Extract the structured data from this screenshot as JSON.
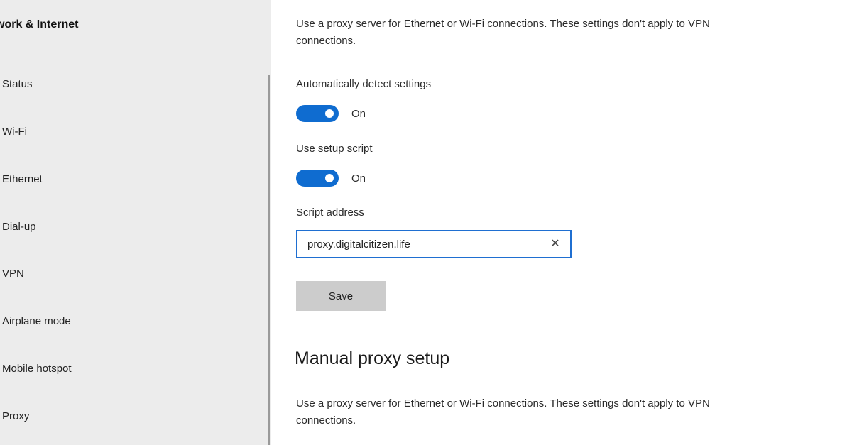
{
  "sidebar": {
    "title": "work & Internet",
    "items": [
      {
        "label": "Status"
      },
      {
        "label": "Wi-Fi"
      },
      {
        "label": "Ethernet"
      },
      {
        "label": "Dial-up"
      },
      {
        "label": "VPN"
      },
      {
        "label": "Airplane mode"
      },
      {
        "label": "Mobile hotspot"
      },
      {
        "label": "Proxy"
      }
    ]
  },
  "automatic": {
    "description": "Use a proxy server for Ethernet or Wi-Fi connections. These settings don't apply to VPN connections.",
    "detect_label": "Automatically detect settings",
    "detect_state": "On",
    "script_label": "Use setup script",
    "script_state": "On",
    "address_label": "Script address",
    "address_value": "proxy.digitalcitizen.life",
    "save_label": "Save"
  },
  "manual": {
    "heading": "Manual proxy setup",
    "description": "Use a proxy server for Ethernet or Wi-Fi connections. These settings don't apply to VPN connections."
  },
  "colors": {
    "accent": "#0f6cd0",
    "sidebar_bg": "#ececec",
    "button_bg": "#cccccc"
  }
}
